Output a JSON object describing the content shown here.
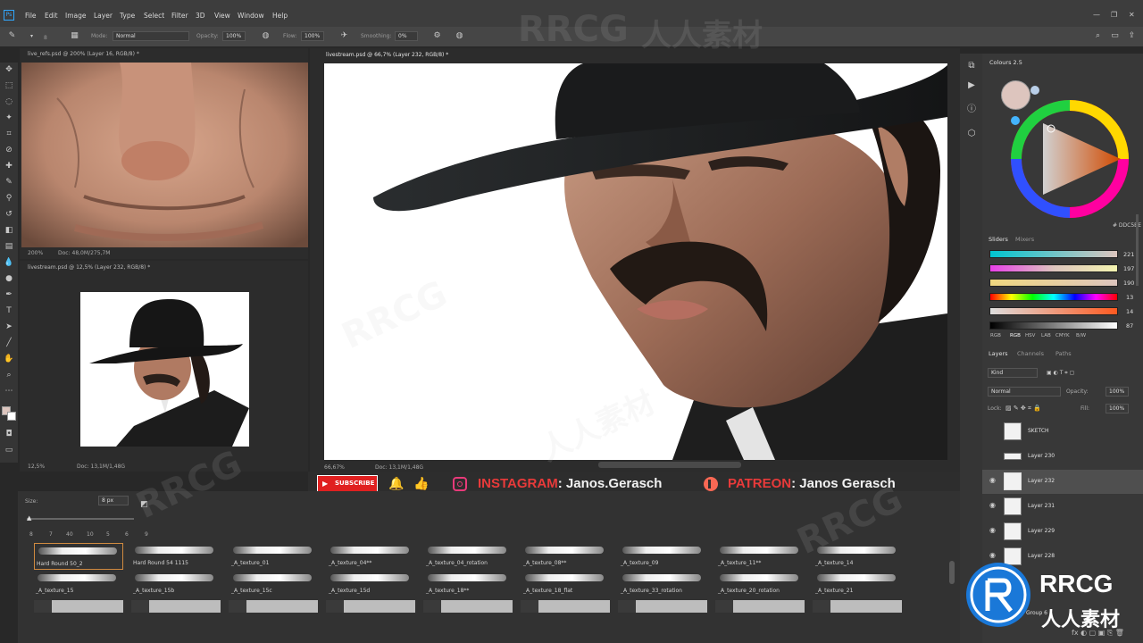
{
  "menubar": {
    "app_icon": "Ps",
    "items": [
      "File",
      "Edit",
      "Image",
      "Layer",
      "Type",
      "Select",
      "Filter",
      "3D",
      "View",
      "Window",
      "Help"
    ]
  },
  "options": {
    "size_value": "8",
    "mode_label": "Mode:",
    "mode_value": "Normal",
    "opacity_label": "Opacity:",
    "opacity_value": "100%",
    "flow_label": "Flow:",
    "flow_value": "100%",
    "smoothing_label": "Smoothing:",
    "smoothing_value": "0%"
  },
  "docs": {
    "refs": {
      "tab": "live_refs.psd @ 200% (Layer 16, RGB/8) *",
      "zoom": "200%",
      "doc": "Doc: 48,0M/275,7M"
    },
    "nav": {
      "tab": "livestream.psd @ 12,5% (Layer 232, RGB/8) *",
      "zoom": "12,5%",
      "doc": "Doc: 13,1M/1,48G"
    },
    "main": {
      "tab": "livestream.psd @ 66,7% (Layer 232, RGB/8) *",
      "zoom": "66,67%",
      "doc": "Doc: 13,1M/1,48G"
    }
  },
  "colours": {
    "title": "Colours 2.5",
    "hex": "# DDC5BE",
    "tab_sliders": "Sliders",
    "tab_mixers": "Mixers",
    "slider_values": [
      "221",
      "197",
      "190",
      "13",
      "14",
      "87"
    ],
    "modes": [
      "RGB",
      "RGB",
      "HSV",
      "LAB",
      "CMYK",
      "B/W"
    ]
  },
  "layers_panel": {
    "tabs": [
      "Layers",
      "Channels",
      "Paths"
    ],
    "kind": "Kind",
    "blend": "Normal",
    "opacity_label": "Opacity:",
    "opacity": "100%",
    "lock_label": "Lock:",
    "fill_label": "Fill:",
    "fill": "100%",
    "layers": [
      "SKETCH",
      "Layer 230",
      "Layer 232",
      "Layer 231",
      "Layer 229",
      "Layer 228",
      "Group 6"
    ]
  },
  "social": {
    "subscribe": "SUBSCRIBE",
    "instagram_label": "INSTAGRAM",
    "instagram_handle": ": Janos.Gerasch",
    "patreon_label": "PATREON",
    "patreon_handle": ": Janos Gerasch"
  },
  "brush_panel": {
    "size_label": "Size:",
    "size_value": "8 px",
    "preset_sizes": [
      "8",
      "7",
      "40",
      "10",
      "5",
      "6",
      "9"
    ],
    "brushes": [
      "Hard Round 50_2",
      "Hard Round 54 1115",
      "_A_texture_01",
      "_A_texture_04**",
      "_A_texture_04_rotation",
      "_A_texture_08**",
      "_A_texture_09",
      "_A_texture_11**",
      "_A_texture_14",
      "_A_texture_15",
      "_A_texture_15b",
      "_A_texture_15c",
      "_A_texture_15d",
      "_A_texture_18**",
      "_A_texture_18_flat",
      "_A_texture_33_rotation",
      "_A_texture_20_rotation",
      "_A_texture_21"
    ]
  },
  "watermark": {
    "text": "RRCG",
    "cn": "人人素材"
  }
}
